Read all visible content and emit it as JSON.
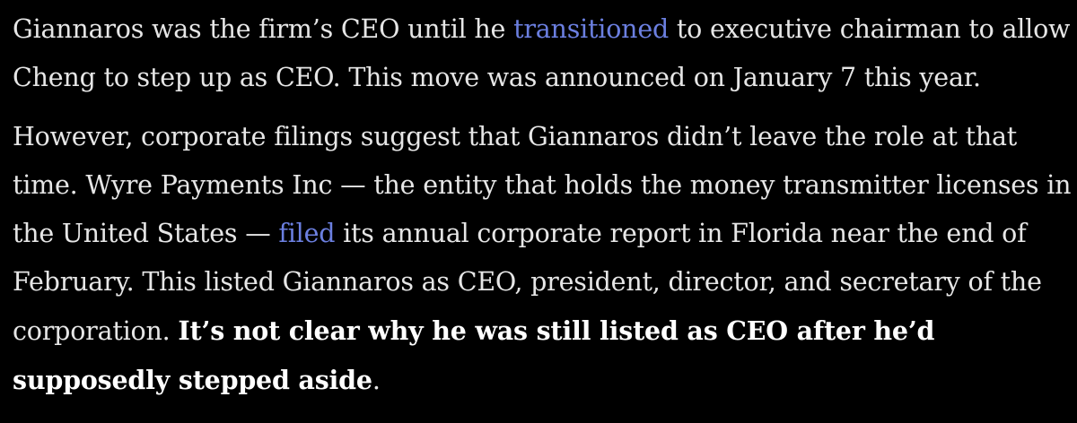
{
  "article": {
    "paragraph_1": {
      "before_link": "Giannaros was the firm’s CEO until he ",
      "link_text": "transitioned",
      "after_link": " to executive chairman to allow Cheng to step up as CEO. This move was announced on January 7 this year."
    },
    "paragraph_2": {
      "before_link": "However, corporate filings suggest that Giannaros didn’t leave the role at that time. Wyre Payments Inc — the entity that holds the money transmitter licenses in the United States — ",
      "link_text": "filed",
      "after_link": " its annual corporate report in Florida near the end of February. This listed Giannaros as CEO, president, director, and secretary of the corporation. ",
      "bold_text": "It’s not clear why he was still listed as CEO after he’d supposedly stepped aside",
      "closing": "."
    }
  },
  "colors": {
    "background": "#000000",
    "text": "#e6e6e6",
    "link": "#6b7fe0",
    "bold": "#ffffff"
  }
}
